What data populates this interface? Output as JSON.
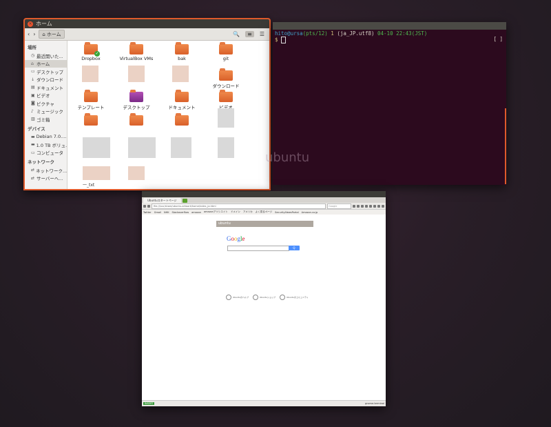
{
  "file_manager": {
    "window_title": "ホーム",
    "breadcrumb": "ホーム",
    "sidebar": {
      "sections": [
        {
          "heading": "場所",
          "items": [
            {
              "label": "最近開いた...",
              "icon": "clock-icon"
            },
            {
              "label": "ホーム",
              "icon": "home-icon",
              "selected": true
            },
            {
              "label": "デスクトップ",
              "icon": "desktop-icon"
            },
            {
              "label": "ダウンロード",
              "icon": "download-icon"
            },
            {
              "label": "ドキュメント",
              "icon": "document-icon"
            },
            {
              "label": "ビデオ",
              "icon": "video-icon"
            },
            {
              "label": "ピクチャ",
              "icon": "camera-icon"
            },
            {
              "label": "ミュージック",
              "icon": "music-icon"
            },
            {
              "label": "ゴミ箱",
              "icon": "trash-icon"
            }
          ]
        },
        {
          "heading": "デバイス",
          "items": [
            {
              "label": "Debian 7.0....",
              "icon": "drive-icon"
            },
            {
              "label": "1.0 TB ボリュ...",
              "icon": "drive-icon"
            },
            {
              "label": "コンピュータ",
              "icon": "computer-icon"
            }
          ]
        },
        {
          "heading": "ネットワーク",
          "items": [
            {
              "label": "ネットワーク...",
              "icon": "network-icon"
            },
            {
              "label": "サーバーへ...",
              "icon": "server-icon"
            }
          ]
        }
      ]
    },
    "folders": [
      {
        "label": "Dropbox"
      },
      {
        "label": "VirtualBox VMs"
      },
      {
        "label": "bak"
      },
      {
        "label": "git"
      },
      {
        "label": "ダウンロード"
      },
      {
        "label": "テンプレート"
      },
      {
        "label": "デスクトップ"
      },
      {
        "label": "ドキュメント"
      },
      {
        "label": "ビデオ"
      }
    ],
    "partial_label": "一_txt"
  },
  "terminal": {
    "user_host": "hito@ursa",
    "pts": "(pts/12)",
    "count": "1",
    "locale": "(ja_JP.utf8)",
    "datetime": "04-10 22:43(JST)",
    "prompt": "$",
    "right_marker": "[ ]"
  },
  "desktop_logo": "ubuntu",
  "browser": {
    "tab_title": "Ubuntuスタートページ",
    "url": "file:///usr/share/ubuntu-artwork/home/index_ja.html",
    "search_placeholder": "Google",
    "bookmarks": [
      "Twitter",
      "Gmail",
      "NHK",
      "Stackoverflow",
      "amazon",
      "amazonアソシエイト",
      "ドメイン",
      "アメリカ",
      "よく見るページ",
      "Security.NewsPortal",
      "Amazon.co.jp"
    ],
    "page_header": "ubuntu",
    "search_button": "Q",
    "links": [
      "Ubuntuのヘルプ",
      "Ubuntuショップ",
      "Ubuntuのコミュニティ"
    ],
    "status_mode": "INSERT",
    "status_right": "gnome-terminal"
  },
  "colors": {
    "accent": "#e05a2b",
    "terminal_bg": "#2c0a1e",
    "desktop_bg": "#2a1e28"
  }
}
